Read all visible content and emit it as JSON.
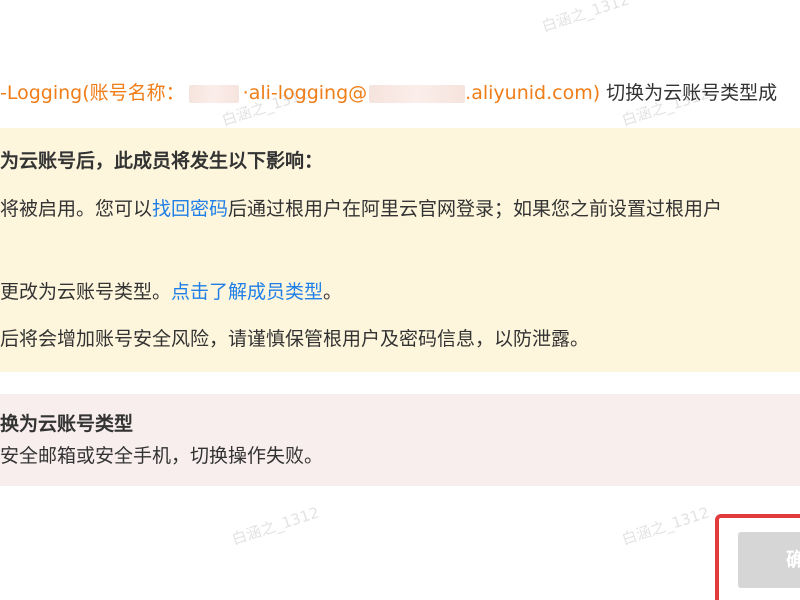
{
  "header": {
    "prefix": "-Logging(账号名称：",
    "account_mid": "·ali-logging@",
    "account_suffix": ".aliyunid.com)",
    "trailing": " 切换为云账号类型成"
  },
  "warning": {
    "title": "为云账号后，此成员将发生以下影响：",
    "line1_before": "将被启用。您可以",
    "line1_link": "找回密码",
    "line1_after": "后通过根用户在阿里云官网登录；如果您之前设置过根用户",
    "line2_before": "更改为云账号类型。",
    "line2_link": "点击了解成员类型",
    "line2_after": "。",
    "line3": "后将会增加账号安全风险，请谨慎保管根用户及密码信息，以防泄露。"
  },
  "error": {
    "title": "换为云账号类型",
    "detail": "安全邮箱或安全手机，切换操作失败。"
  },
  "footer": {
    "confirm_label": "确"
  },
  "watermark": {
    "text": "白涵之_1312"
  },
  "colors": {
    "orange": "#ef7d18",
    "link_blue": "#1f7fe6",
    "warning_bg": "#fdf6dd",
    "error_bg": "#f8eeee",
    "highlight_red": "#e23b3b",
    "disabled_button": "#d6d6d6"
  }
}
